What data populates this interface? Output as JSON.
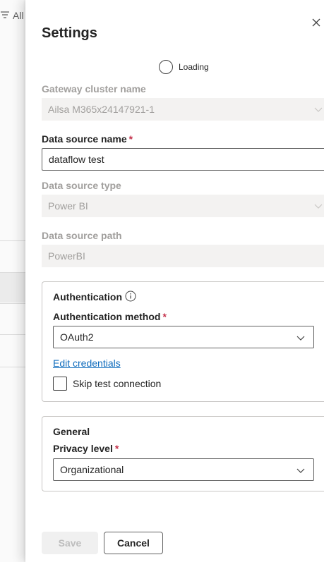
{
  "background": {
    "filter_label": "All"
  },
  "panel": {
    "title": "Settings",
    "loading_label": "Loading",
    "gateway_cluster": {
      "label": "Gateway cluster name",
      "value": "Ailsa M365x24147921-1"
    },
    "data_source_name": {
      "label": "Data source name",
      "required_mark": "*",
      "value": "dataflow test"
    },
    "data_source_type": {
      "label": "Data source type",
      "value": "Power BI"
    },
    "data_source_path": {
      "label": "Data source path",
      "value": "PowerBI"
    },
    "authentication": {
      "title": "Authentication",
      "method_label": "Authentication method",
      "required_mark": "*",
      "method_value": "OAuth2",
      "edit_credentials": "Edit credentials",
      "skip_test_label": "Skip test connection",
      "skip_test_checked": false
    },
    "general": {
      "title": "General",
      "privacy_label": "Privacy level",
      "required_mark": "*",
      "privacy_value": "Organizational"
    },
    "buttons": {
      "save": "Save",
      "cancel": "Cancel"
    }
  }
}
